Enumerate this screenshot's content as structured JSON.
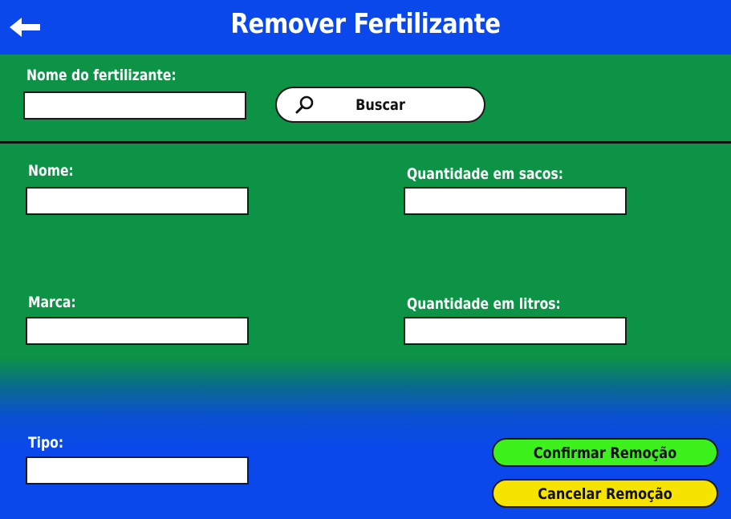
{
  "header": {
    "title": "Remover Fertilizante",
    "back_icon": "arrow-left-icon",
    "background": "#0a48ec"
  },
  "search": {
    "label": "Nome do fertilizante:",
    "value": "",
    "button_label": "Buscar",
    "button_icon": "magnifier-icon"
  },
  "form": {
    "nome": {
      "label": "Nome:",
      "value": ""
    },
    "marca": {
      "label": "Marca:",
      "value": ""
    },
    "tipo": {
      "label": "Tipo:",
      "value": ""
    },
    "quantidade_sacos": {
      "label": "Quantidade em sacos:",
      "value": ""
    },
    "quantidade_litros": {
      "label": "Quantidade em litros:",
      "value": ""
    }
  },
  "actions": {
    "confirm_label": "Confirmar Remoção",
    "confirm_color": "#3df21c",
    "cancel_label": "Cancelar Remoção",
    "cancel_color": "#f7e300"
  },
  "colors": {
    "green_panel": "#0c9346",
    "blue": "#0a48ec"
  }
}
